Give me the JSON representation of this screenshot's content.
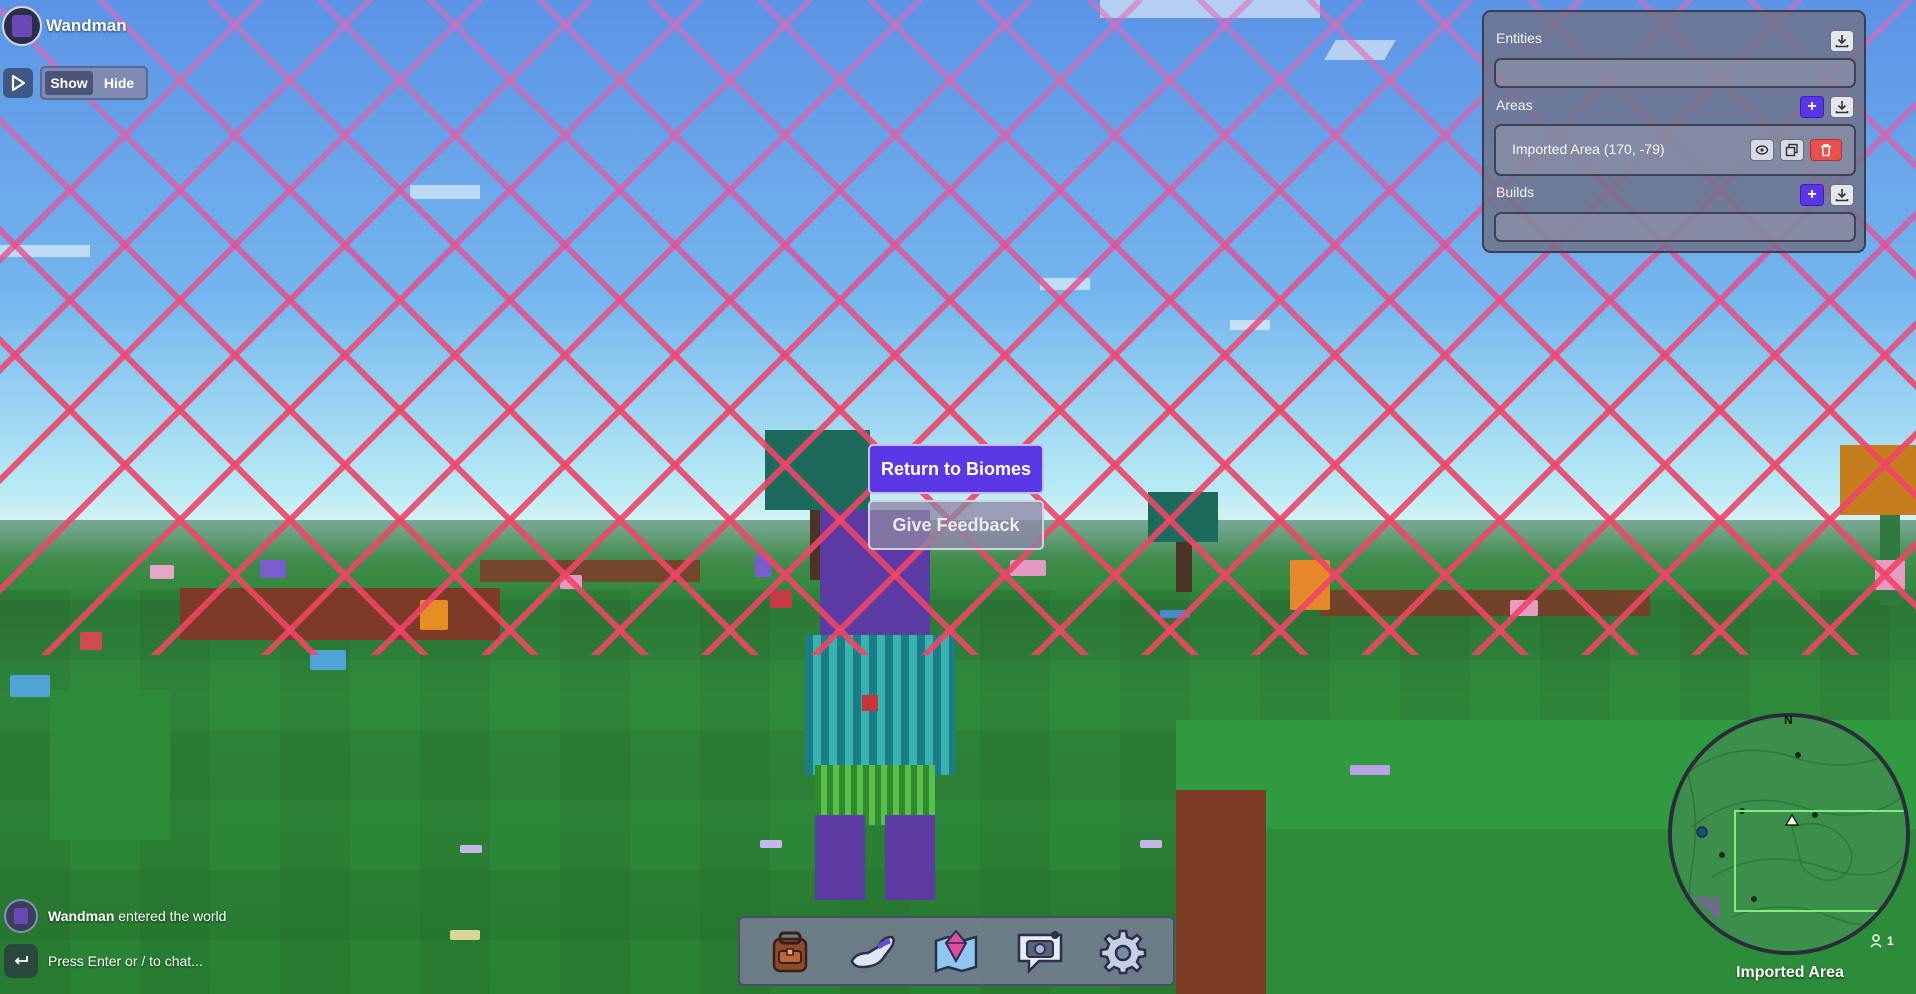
{
  "user": {
    "name": "Wandman"
  },
  "view_toggle": {
    "show_label": "Show",
    "hide_label": "Hide",
    "active": "Show"
  },
  "panel": {
    "entities": {
      "title": "Entities"
    },
    "areas": {
      "title": "Areas",
      "items": [
        {
          "label": "Imported Area (170, -79)"
        }
      ]
    },
    "builds": {
      "title": "Builds"
    }
  },
  "menu": {
    "return_label": "Return to Biomes",
    "feedback_label": "Give Feedback"
  },
  "hotbar": {
    "slots": [
      "backpack-icon",
      "glove-icon",
      "map-crystal-icon",
      "camera-chat-icon",
      "settings-gear-icon"
    ]
  },
  "chat": {
    "messages": [
      {
        "user": "Wandman",
        "text": "entered the world"
      }
    ],
    "placeholder": "Press Enter or / to chat..."
  },
  "minimap": {
    "compass": "N",
    "area_name": "Imported Area",
    "players": "1"
  },
  "colors": {
    "accent": "#5a38e6",
    "danger": "#e9514f",
    "fence": "#e8406b"
  }
}
